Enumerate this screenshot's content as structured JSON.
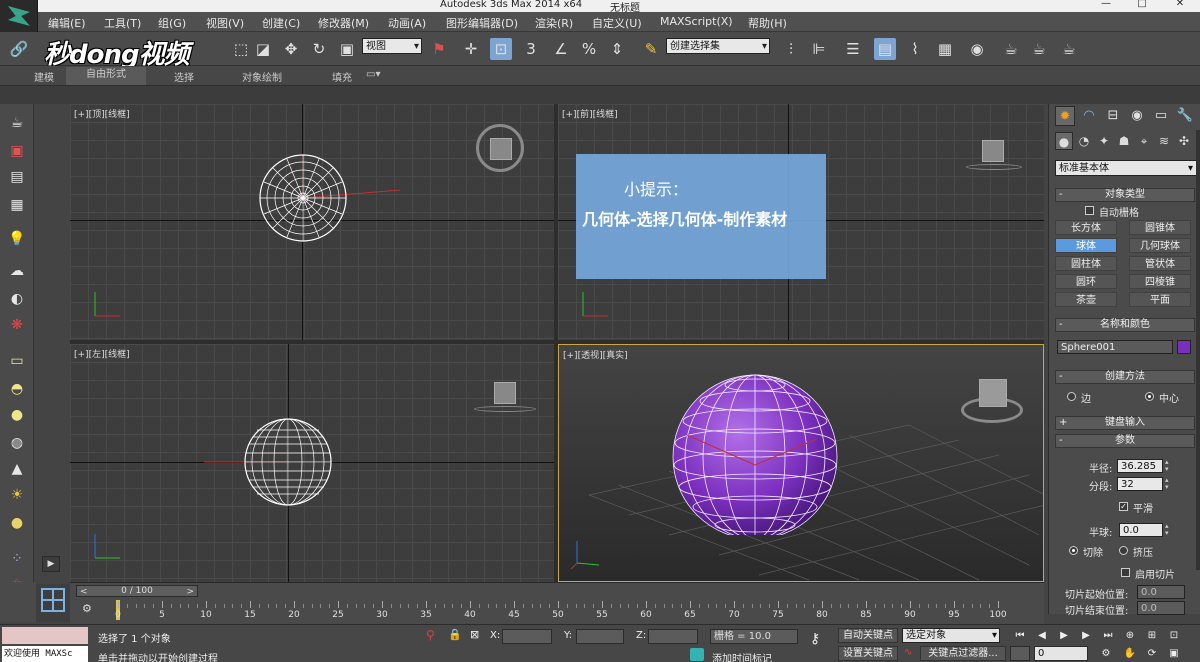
{
  "window": {
    "app_title": "Autodesk 3ds Max  2014 x64",
    "doc_title": "无标题",
    "min": "—",
    "max": "□",
    "close": "✕"
  },
  "menu": [
    "编辑(E)",
    "工具(T)",
    "组(G)",
    "视图(V)",
    "创建(C)",
    "修改器(M)",
    "动画(A)",
    "图形编辑器(D)",
    "渲染(R)",
    "自定义(U)",
    "MAXScript(X)",
    "帮助(H)"
  ],
  "toolbar": {
    "watermark": "秒dong视频",
    "view_select": "视图",
    "selection_set": "创建选择集",
    "snap_3": "3",
    "snap_percent": "%"
  },
  "ribbon": {
    "tabs": [
      "建模",
      "自由形式",
      "选择",
      "对象绘制",
      "填充"
    ],
    "active": "自由形式"
  },
  "viewports": {
    "top": "[+][顶][线框]",
    "front": "[+][前][线框]",
    "left": "[+][左][线框]",
    "perspective": "[+][透视][真实]"
  },
  "hint": {
    "title": "小提示：",
    "body": "几何体-选择几何体-制作素材"
  },
  "command_panel": {
    "category": "标准基本体",
    "object_type": "对象类型",
    "autogrid": "自动栅格",
    "buttons": [
      "长方体",
      "圆锥体",
      "球体",
      "几何球体",
      "圆柱体",
      "管状体",
      "圆环",
      "四棱锥",
      "茶壶",
      "平面"
    ],
    "active_button": "球体",
    "name_color": "名称和颜色",
    "object_name": "Sphere001",
    "object_color": "#7b2fbf",
    "creation_method": "创建方法",
    "method_edge": "边",
    "method_center": "中心",
    "keyboard_entry": "键盘输入",
    "parameters": "参数",
    "radius_label": "半径:",
    "radius": "36.285",
    "segments_label": "分段:",
    "segments": "32",
    "smooth": "平滑",
    "hemisphere_label": "半球:",
    "hemisphere": "0.0",
    "chop": "切除",
    "squash": "挤压",
    "enable_slice": "启用切片",
    "slice_from_label": "切片起始位置:",
    "slice_from": "0.0",
    "slice_to_label": "切片结束位置:",
    "slice_to": "0.0"
  },
  "timeline": {
    "frame": "0 / 100",
    "prev": "<",
    "next": ">",
    "ticks": [
      0,
      5,
      10,
      15,
      20,
      25,
      30,
      35,
      40,
      45,
      50,
      55,
      60,
      65,
      70,
      75,
      80,
      85,
      90,
      95,
      100
    ]
  },
  "status": {
    "maxscript_label": "欢迎使用 MAXSc",
    "selected": "选择了 1 个对象",
    "prompt": "单击并拖动以开始创建过程",
    "x_label": "X:",
    "y_label": "Y:",
    "z_label": "Z:",
    "grid": "栅格 = 10.0",
    "add_time_tag": "添加时间标记",
    "auto_key": "自动关键点",
    "set_key": "设置关键点",
    "selected_object": "选定对象",
    "key_filters": "关键点过滤器...",
    "current_frame": "0"
  }
}
